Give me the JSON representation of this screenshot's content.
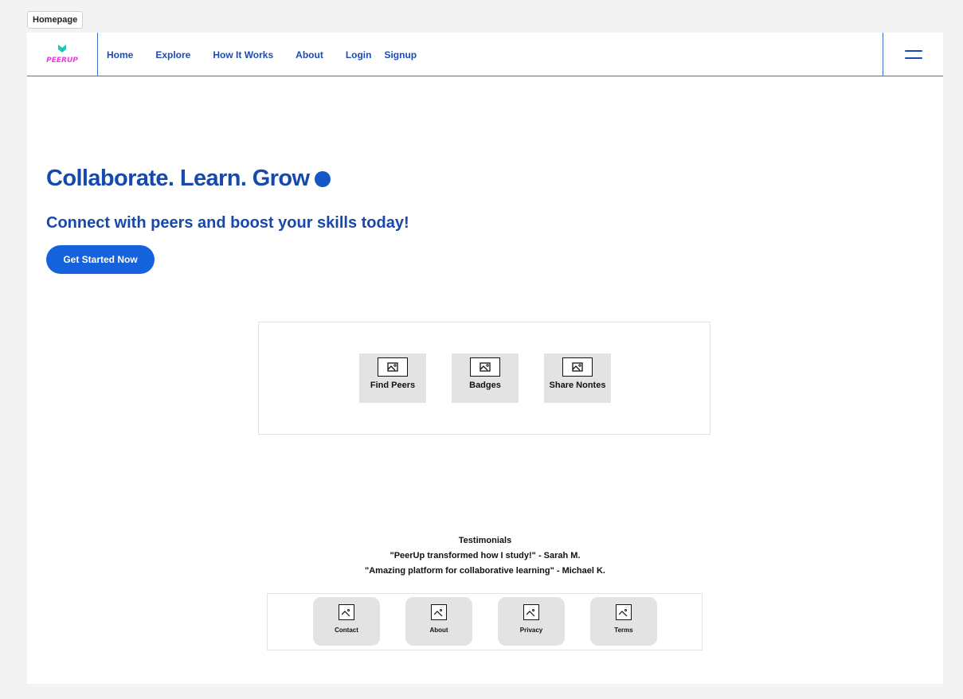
{
  "frame_label": "Homepage",
  "nav": {
    "logo_text": "PEERUP",
    "links": [
      "Home",
      "Explore",
      "How It Works",
      "About",
      "Login",
      "Signup"
    ]
  },
  "hero": {
    "title": "Collaborate. Learn. Grow",
    "subtitle": "Connect with peers and boost your skills today!",
    "cta_label": "Get Started Now"
  },
  "features": [
    {
      "label": "Find Peers",
      "icon": "image-placeholder-icon"
    },
    {
      "label": "Badges",
      "icon": "image-placeholder-icon"
    },
    {
      "label": "Share Nontes",
      "icon": "image-placeholder-icon"
    }
  ],
  "testimonials": {
    "heading": "Testimonials",
    "quotes": [
      "\"PeerUp transformed how I study!\" - Sarah M.",
      "\"Amazing platform for collaborative learning\" - Michael K."
    ]
  },
  "footer": [
    {
      "label": "Contact",
      "icon": "image-placeholder-icon"
    },
    {
      "label": "About",
      "icon": "image-placeholder-icon"
    },
    {
      "label": "Privacy",
      "icon": "image-placeholder-icon"
    },
    {
      "label": "Terms",
      "icon": "image-placeholder-icon"
    }
  ],
  "colors": {
    "brand_blue": "#1749ad",
    "cta_blue": "#1462dc",
    "nav_border": "#3f73c8"
  }
}
